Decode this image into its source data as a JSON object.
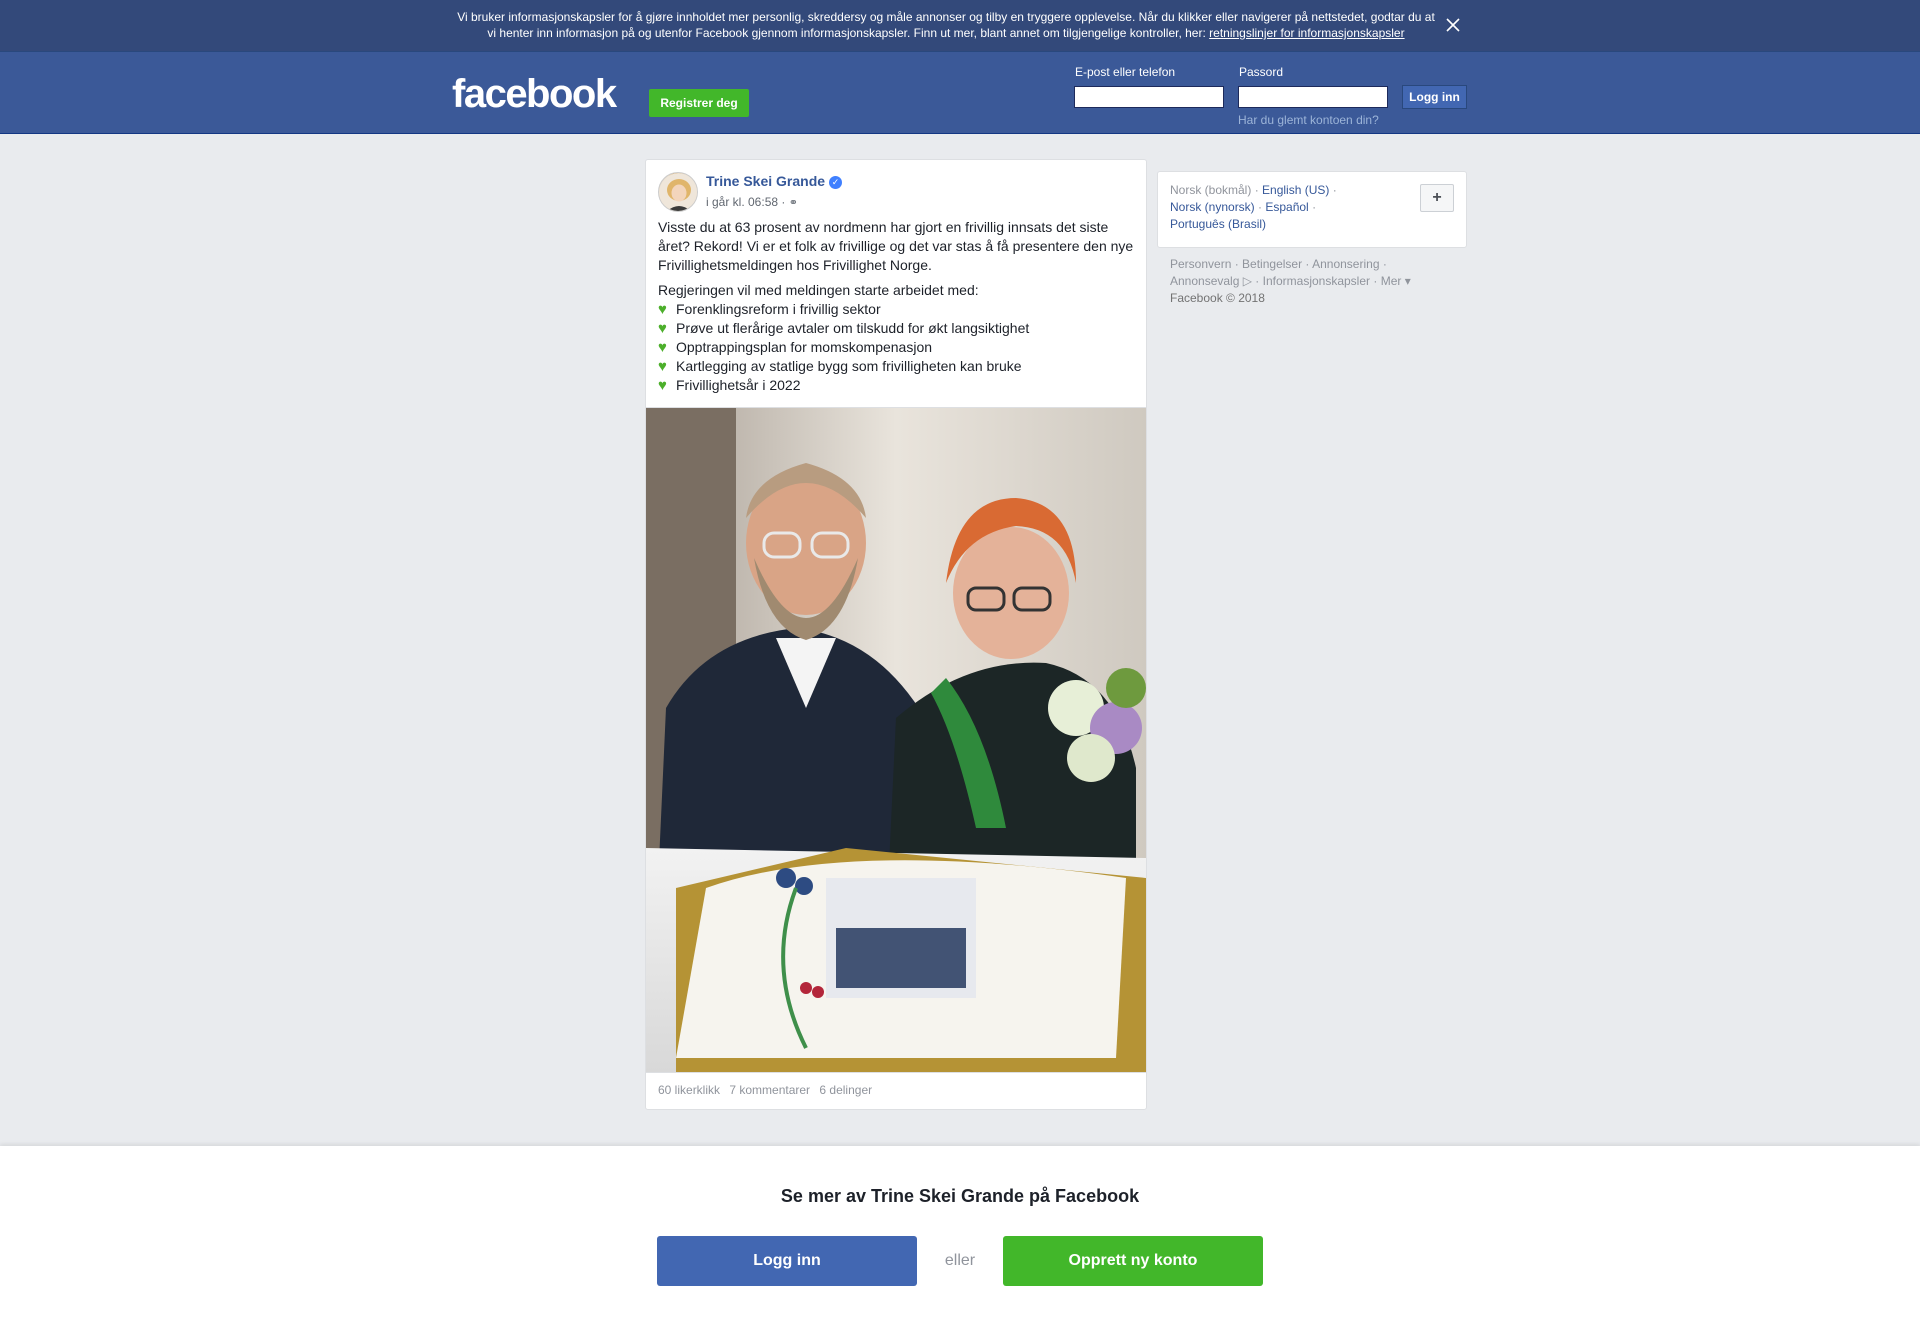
{
  "cookie_banner": {
    "text": "Vi bruker informasjonskapsler for å gjøre innholdet mer personlig, skreddersy og måle annonser og tilby en tryggere opplevelse. Når du klikker eller navigerer på nettstedet, godtar du at vi henter inn informasjon på og utenfor Facebook gjennom informasjonskapsler. Finn ut mer, blant annet om tilgjengelige kontroller, her: ",
    "link": "retningslinjer for informasjonskapsler",
    "close_icon": "close-icon"
  },
  "header": {
    "logo": "facebook",
    "register_label": "Registrer deg",
    "email_label": "E-post eller telefon",
    "password_label": "Passord",
    "login_label": "Logg inn",
    "forgot_label": "Har du glemt kontoen din?"
  },
  "post": {
    "author": "Trine Skei Grande",
    "verified_icon": "verified-badge-icon",
    "timestamp": "i går kl. 06:58 ·",
    "privacy_icon": "globe-icon",
    "paragraph1": "Visste du at 63 prosent av nordmenn har gjort en frivillig innsats det siste året? Rekord! Vi er et folk av frivillige og det var stas å få presentere den nye Frivillighetsmeldingen hos Frivillighet Norge.",
    "intro": "Regjeringen vil med meldingen starte arbeidet med:",
    "bullets": [
      "Forenklingsreform i frivillig sektor",
      "Prøve ut flerårige avtaler om tilskudd for økt langsiktighet",
      "Opptrappingsplan for momskompenasjon",
      "Kartlegging av statlige bygg som frivilligheten kan bruke",
      "Frivillighetsår i 2022"
    ],
    "bullet_icon": "green-heart-icon",
    "likes": "60 likerklikk",
    "comments": "7 kommentarer",
    "shares": "6 delinger"
  },
  "sidebar": {
    "languages": {
      "current": "Norsk (bokmål)",
      "options": [
        "English (US)",
        "Norsk (nynorsk)",
        "Español",
        "Português (Brasil)"
      ]
    },
    "more_languages_label": "+",
    "footer": {
      "links": [
        "Personvern",
        "Betingelser",
        "Annonsering",
        "Annonsevalg",
        "Informasjonskapsler",
        "Mer"
      ],
      "copyright": "Facebook © 2018"
    }
  },
  "bottom_prompt": {
    "title": "Se mer av Trine Skei Grande på Facebook",
    "login_label": "Logg inn",
    "or_label": "eller",
    "create_label": "Opprett ny konto"
  },
  "colors": {
    "brand_blue": "#3b5998",
    "button_blue": "#4267b2",
    "green": "#42b72a",
    "link": "#365899",
    "background": "#e9ebee"
  }
}
